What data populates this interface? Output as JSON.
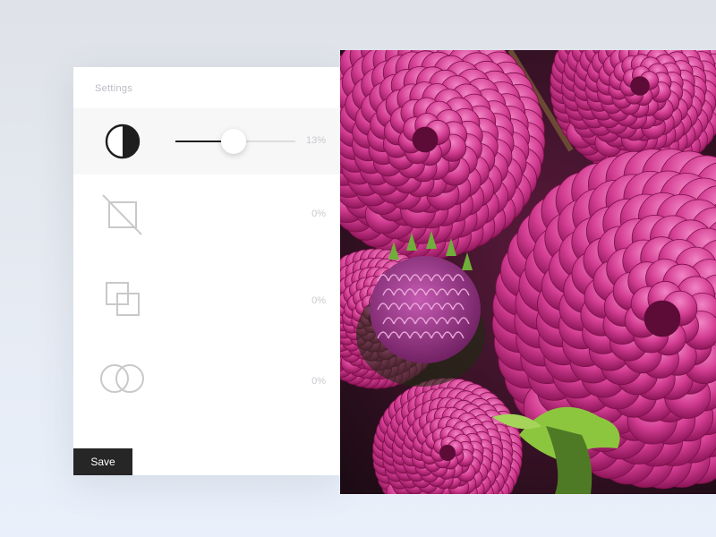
{
  "panel": {
    "title": "Settings",
    "rows": [
      {
        "name": "contrast",
        "icon": "contrast-icon",
        "value_label": "13%",
        "value": 0.13
      },
      {
        "name": "crop",
        "icon": "crop-icon",
        "value_label": "0%",
        "value": 0
      },
      {
        "name": "overlay",
        "icon": "overlay-icon",
        "value_label": "0%",
        "value": 0
      },
      {
        "name": "blend",
        "icon": "blend-icon",
        "value_label": "0%",
        "value": 0
      }
    ],
    "save_label": "Save"
  },
  "photo": {
    "subject": "pink dahlia flowers"
  },
  "colors": {
    "accent_dark": "#262626",
    "icon_gray": "#c9c9c9",
    "flower_pink": "#c8237d"
  }
}
